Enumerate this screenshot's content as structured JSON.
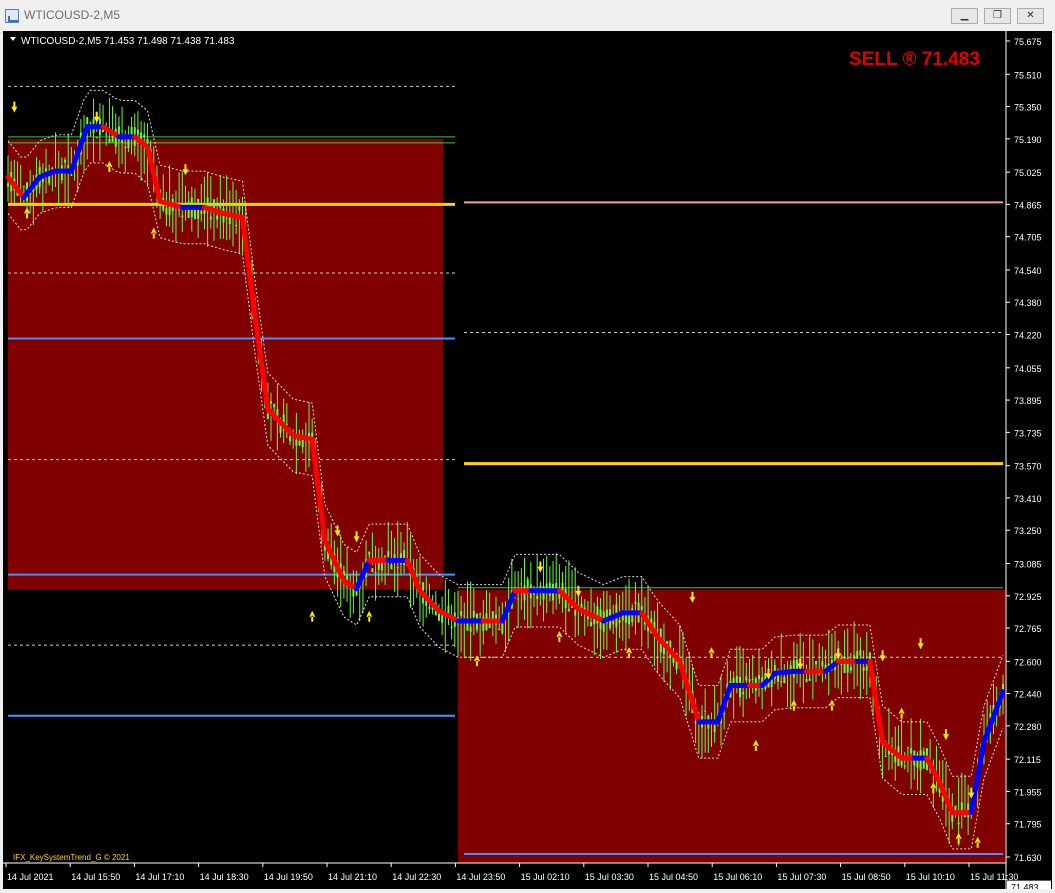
{
  "window": {
    "title": "WTICOUSD-2,M5",
    "minimize_glyph": "▁",
    "maximize_glyph": "❐",
    "close_glyph": "✕"
  },
  "chart": {
    "header": "WTICOUSD-2,M5  71.453 71.498 71.438 71.483",
    "signal": "SELL ® 71.483",
    "watermark": "IFX_KeySystemTrend_G © 2021",
    "last_price": "71.483",
    "colors": {
      "background": "#000000",
      "zone": "#800000",
      "candle": "#66ff33",
      "trend_down": "#ff0000",
      "trend_up": "#0000ff",
      "signal": "#ff0000",
      "arrow": "#ffee00",
      "yellow_level": "#ffd700",
      "blue_level": "#4a90ff",
      "pink_level": "#f2a0a0"
    }
  },
  "chart_data": {
    "type": "candlestick",
    "title": "WTICOUSD-2,M5",
    "ylim": [
      71.63,
      75.675
    ],
    "y_ticks": [
      "75.675",
      "75.510",
      "75.350",
      "75.190",
      "75.025",
      "74.865",
      "74.705",
      "74.540",
      "74.380",
      "74.220",
      "74.055",
      "73.895",
      "73.735",
      "73.570",
      "73.410",
      "73.250",
      "73.085",
      "72.925",
      "72.765",
      "72.600",
      "72.440",
      "72.280",
      "72.115",
      "71.955",
      "71.795",
      "71.630"
    ],
    "x_ticks": [
      "14 Jul 2021",
      "14 Jul 15:50",
      "14 Jul 17:10",
      "14 Jul 18:30",
      "14 Jul 19:50",
      "14 Jul 21:10",
      "14 Jul 22:30",
      "14 Jul 23:50",
      "15 Jul 02:10",
      "15 Jul 03:30",
      "15 Jul 04:50",
      "15 Jul 06:10",
      "15 Jul 07:30",
      "15 Jul 08:50",
      "15 Jul 10:10",
      "15 Jul 11:30"
    ],
    "levels": {
      "day1_high_solid": 75.2,
      "day1_yellow": 74.865,
      "day1_blue_mid": 74.2,
      "day1_blue_low": 73.03,
      "day1_blue_bottom": 72.33,
      "day1_zone_top": 75.19,
      "day1_zone_bottom": 72.955,
      "day1_dotted": [
        75.45,
        74.525,
        73.6,
        72.68
      ],
      "day2_pink": 74.875,
      "day2_yellow": 73.58,
      "day2_zone_top": 72.955,
      "day2_blue_bottom": 71.645,
      "day2_dotted": [
        74.23,
        72.62
      ]
    },
    "trend": [
      {
        "t": 0,
        "v": 75.0
      },
      {
        "t": 5,
        "v": 74.9
      },
      {
        "t": 10,
        "v": 75.0
      },
      {
        "t": 15,
        "v": 75.03
      },
      {
        "t": 20,
        "v": 75.03
      },
      {
        "t": 25,
        "v": 75.25
      },
      {
        "t": 30,
        "v": 75.25
      },
      {
        "t": 35,
        "v": 75.2
      },
      {
        "t": 40,
        "v": 75.2
      },
      {
        "t": 44,
        "v": 75.15
      },
      {
        "t": 48,
        "v": 74.88
      },
      {
        "t": 55,
        "v": 74.85
      },
      {
        "t": 62,
        "v": 74.85
      },
      {
        "t": 68,
        "v": 74.82
      },
      {
        "t": 74,
        "v": 74.8
      },
      {
        "t": 78,
        "v": 74.3
      },
      {
        "t": 82,
        "v": 73.85
      },
      {
        "t": 90,
        "v": 73.72
      },
      {
        "t": 96,
        "v": 73.7
      },
      {
        "t": 100,
        "v": 73.2
      },
      {
        "t": 106,
        "v": 73.0
      },
      {
        "t": 110,
        "v": 72.96
      },
      {
        "t": 114,
        "v": 73.1
      },
      {
        "t": 120,
        "v": 73.1
      },
      {
        "t": 126,
        "v": 73.1
      },
      {
        "t": 130,
        "v": 72.95
      },
      {
        "t": 136,
        "v": 72.85
      },
      {
        "t": 142,
        "v": 72.8
      },
      {
        "t": 150,
        "v": 72.8
      },
      {
        "t": 156,
        "v": 72.8
      },
      {
        "t": 160,
        "v": 72.95
      },
      {
        "t": 165,
        "v": 72.95
      },
      {
        "t": 174,
        "v": 72.95
      },
      {
        "t": 180,
        "v": 72.86
      },
      {
        "t": 188,
        "v": 72.8
      },
      {
        "t": 194,
        "v": 72.84
      },
      {
        "t": 200,
        "v": 72.84
      },
      {
        "t": 205,
        "v": 72.72
      },
      {
        "t": 212,
        "v": 72.6
      },
      {
        "t": 218,
        "v": 72.3
      },
      {
        "t": 224,
        "v": 72.3
      },
      {
        "t": 228,
        "v": 72.48
      },
      {
        "t": 234,
        "v": 72.48
      },
      {
        "t": 238,
        "v": 72.48
      },
      {
        "t": 242,
        "v": 72.54
      },
      {
        "t": 248,
        "v": 72.55
      },
      {
        "t": 252,
        "v": 72.55
      },
      {
        "t": 258,
        "v": 72.55
      },
      {
        "t": 262,
        "v": 72.6
      },
      {
        "t": 268,
        "v": 72.6
      },
      {
        "t": 272,
        "v": 72.6
      },
      {
        "t": 276,
        "v": 72.2
      },
      {
        "t": 282,
        "v": 72.12
      },
      {
        "t": 286,
        "v": 72.12
      },
      {
        "t": 290,
        "v": 72.12
      },
      {
        "t": 294,
        "v": 72.0
      },
      {
        "t": 298,
        "v": 71.85
      },
      {
        "t": 304,
        "v": 71.85
      },
      {
        "t": 308,
        "v": 72.2
      },
      {
        "t": 314,
        "v": 72.45
      }
    ],
    "markers": {
      "down_arrows": [
        75.28,
        75.23,
        74.97,
        73.18,
        73.15,
        73.0,
        72.88,
        72.85,
        72.47,
        72.52,
        72.57,
        72.56,
        72.62,
        72.17,
        71.88
      ],
      "up_arrows": [
        74.9,
        75.13,
        74.8,
        72.9,
        72.9,
        72.68,
        72.8,
        72.72,
        72.72,
        72.26,
        72.46,
        72.46,
        72.42,
        72.05,
        71.8,
        71.78
      ]
    }
  }
}
